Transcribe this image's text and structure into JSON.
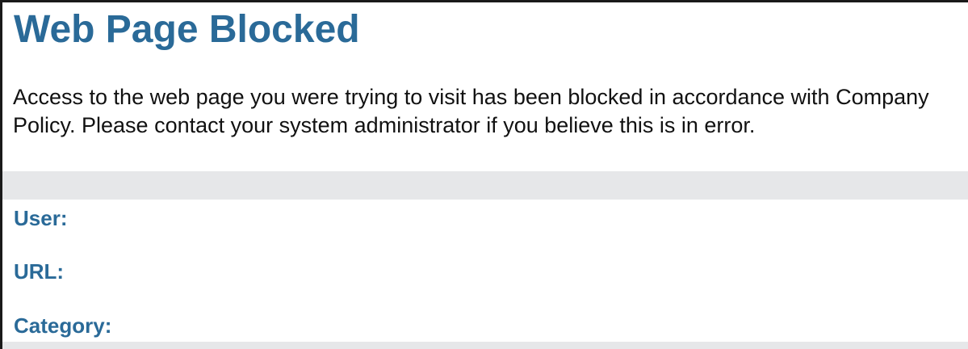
{
  "page": {
    "title": "Web Page Blocked",
    "message": "Access to the web page you were trying to visit has been blocked in accordance with Company Policy. Please contact your system administrator if you believe this is in error."
  },
  "details": {
    "user_label": "User:",
    "user_value": "",
    "url_label": "URL:",
    "url_value": "",
    "category_label": "Category:",
    "category_value": ""
  },
  "colors": {
    "heading": "#2a6a98",
    "text": "#111111",
    "band": "#e6e7e9",
    "border": "#1a1a1a"
  }
}
